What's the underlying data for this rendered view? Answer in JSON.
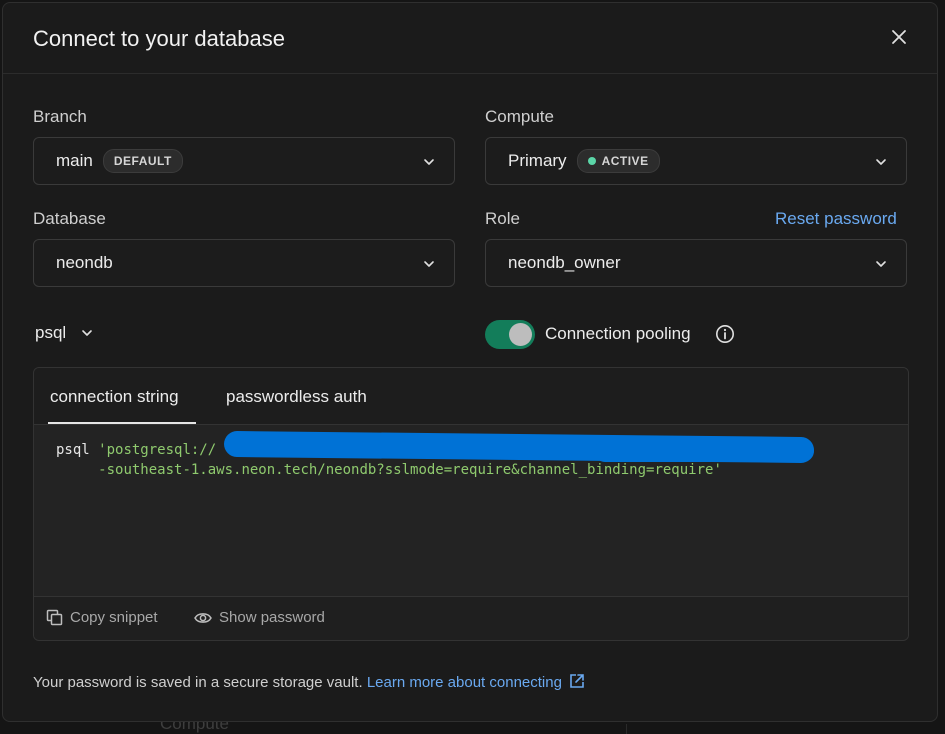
{
  "background": {
    "fragment_bottom": "Compute"
  },
  "dialog": {
    "title": "Connect to your database",
    "close_icon": "close-icon"
  },
  "fields": {
    "branch": {
      "label": "Branch",
      "value": "main",
      "badge": "DEFAULT"
    },
    "compute": {
      "label": "Compute",
      "value": "Primary",
      "badge": "ACTIVE",
      "status_color": "#5bd6a8"
    },
    "database": {
      "label": "Database",
      "value": "neondb"
    },
    "role": {
      "label": "Role",
      "value": "neondb_owner",
      "reset_link": "Reset password"
    }
  },
  "client": {
    "value": "psql"
  },
  "pooling": {
    "label": "Connection pooling",
    "enabled": true,
    "toggle_color": "#137d5a"
  },
  "tabs": [
    {
      "label": "connection string",
      "active": true
    },
    {
      "label": "passwordless auth",
      "active": false
    }
  ],
  "code": {
    "command": "psql",
    "line1_string": "'postgresql://",
    "line2_string": "-southeast-1.aws.neon.tech/neondb?sslmode=require&channel_binding=require'",
    "redaction_color": "#0072d6"
  },
  "actions": {
    "copy_snippet": "Copy snippet",
    "show_password": "Show password"
  },
  "footer": {
    "note": "Your password is saved in a secure storage vault.",
    "link": "Learn more about connecting"
  },
  "colors": {
    "accent_link": "#6aa9f0",
    "surface": "#1b1b1b"
  }
}
